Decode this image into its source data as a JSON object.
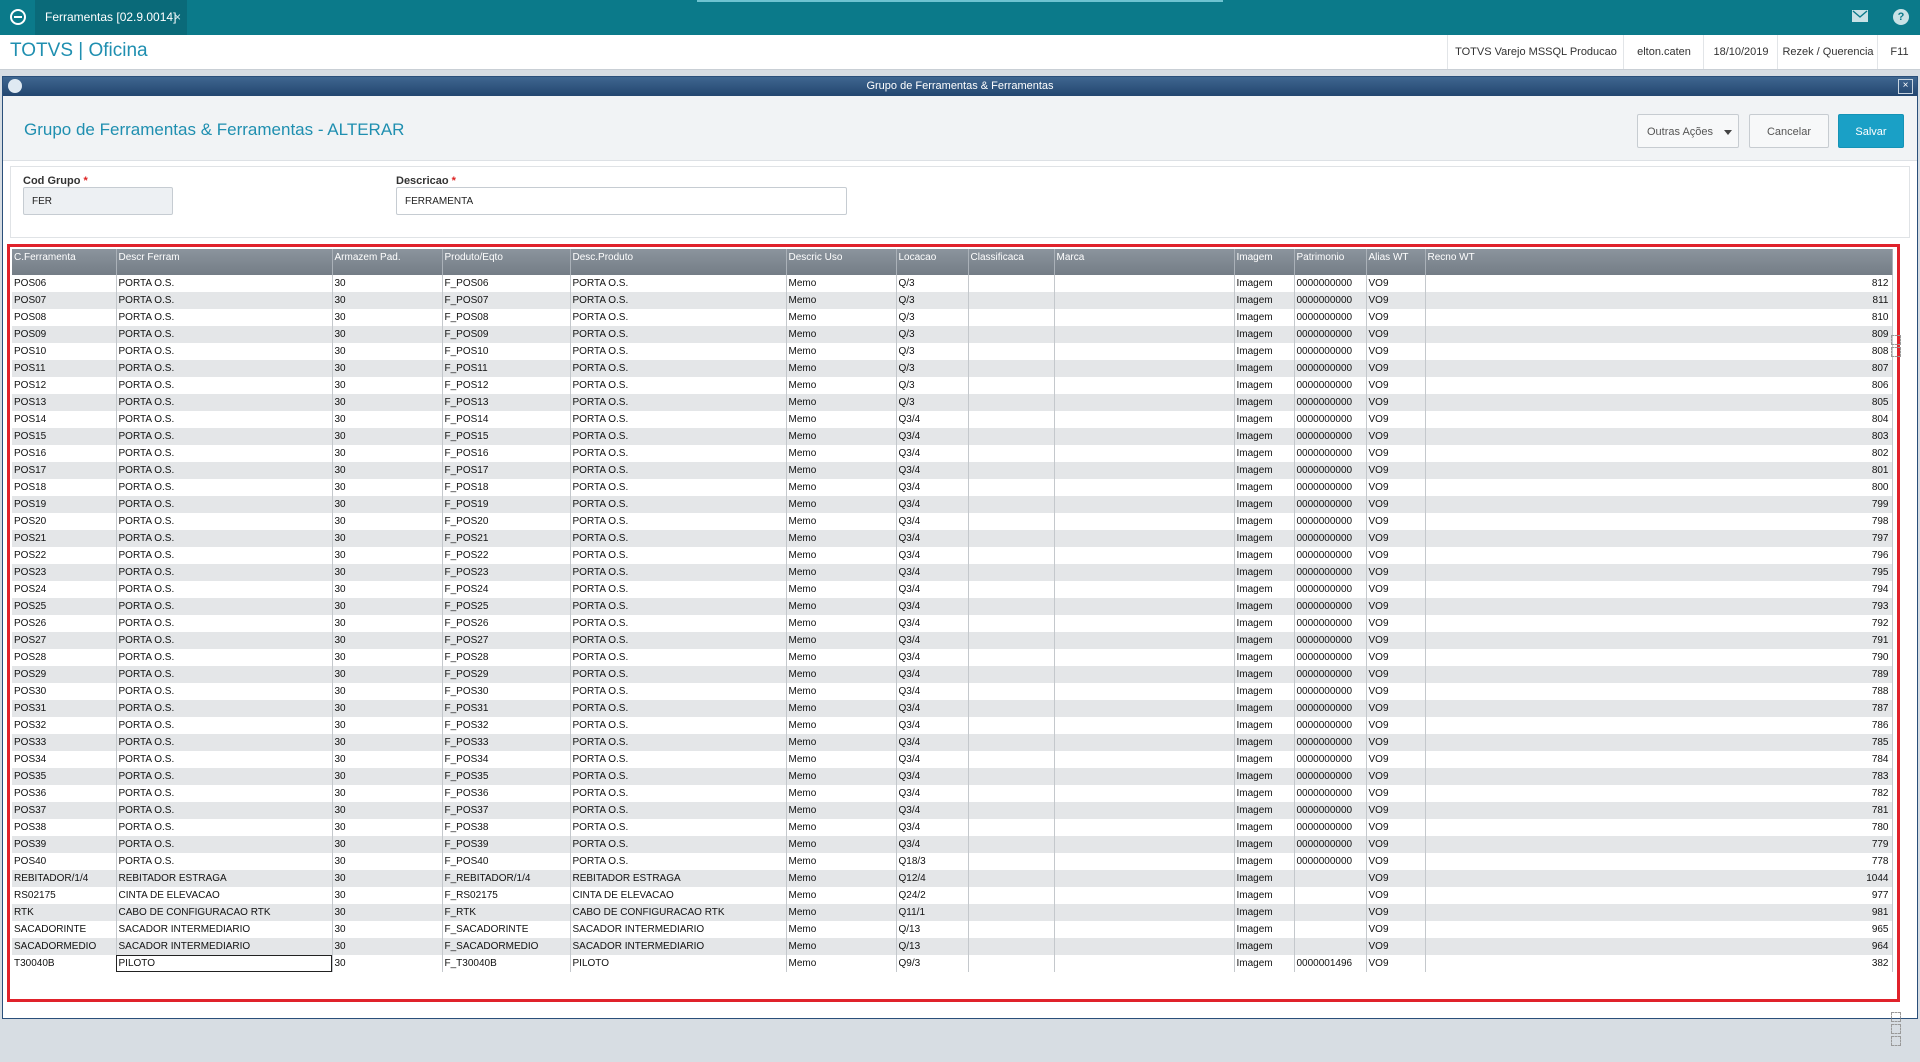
{
  "topbar": {
    "tab_label": "Ferramentas [02.9.0014]",
    "tab_close": "×",
    "help_glyph": "?"
  },
  "appbar": {
    "title": "TOTVS | Oficina",
    "environment": "TOTVS Varejo MSSQL Producao",
    "user": "elton.caten",
    "date": "18/10/2019",
    "company": "Rezek / Querencia",
    "shortcut": "F11"
  },
  "window": {
    "title": "Grupo de Ferramentas & Ferramentas",
    "close_glyph": "×"
  },
  "header": {
    "form_title": "Grupo de Ferramentas & Ferramentas - ALTERAR",
    "other_actions": "Outras Ações",
    "cancel": "Cancelar",
    "save": "Salvar"
  },
  "form": {
    "cod_grupo_label": "Cod Grupo",
    "cod_grupo_value": "FER",
    "descricao_label": "Descricao",
    "descricao_value": "FERRAMENTA",
    "required_mark": "*"
  },
  "grid": {
    "columns": [
      "C.Ferramenta",
      "Descr Ferram",
      "Armazem Pad.",
      "Produto/Eqto",
      "Desc.Produto",
      "Descric Uso",
      "Locacao",
      "Classificaca",
      "Marca",
      "Imagem",
      "Patrimonio",
      "Alias WT",
      "Recno WT"
    ],
    "rows": [
      [
        "POS06",
        "PORTA O.S.",
        "30",
        "F_POS06",
        "PORTA O.S.",
        "Memo",
        "Q/3",
        "",
        "",
        "Imagem",
        "0000000000",
        "VO9",
        "812"
      ],
      [
        "POS07",
        "PORTA O.S.",
        "30",
        "F_POS07",
        "PORTA O.S.",
        "Memo",
        "Q/3",
        "",
        "",
        "Imagem",
        "0000000000",
        "VO9",
        "811"
      ],
      [
        "POS08",
        "PORTA O.S.",
        "30",
        "F_POS08",
        "PORTA O.S.",
        "Memo",
        "Q/3",
        "",
        "",
        "Imagem",
        "0000000000",
        "VO9",
        "810"
      ],
      [
        "POS09",
        "PORTA O.S.",
        "30",
        "F_POS09",
        "PORTA O.S.",
        "Memo",
        "Q/3",
        "",
        "",
        "Imagem",
        "0000000000",
        "VO9",
        "809"
      ],
      [
        "POS10",
        "PORTA O.S.",
        "30",
        "F_POS10",
        "PORTA O.S.",
        "Memo",
        "Q/3",
        "",
        "",
        "Imagem",
        "0000000000",
        "VO9",
        "808"
      ],
      [
        "POS11",
        "PORTA O.S.",
        "30",
        "F_POS11",
        "PORTA O.S.",
        "Memo",
        "Q/3",
        "",
        "",
        "Imagem",
        "0000000000",
        "VO9",
        "807"
      ],
      [
        "POS12",
        "PORTA O.S.",
        "30",
        "F_POS12",
        "PORTA O.S.",
        "Memo",
        "Q/3",
        "",
        "",
        "Imagem",
        "0000000000",
        "VO9",
        "806"
      ],
      [
        "POS13",
        "PORTA O.S.",
        "30",
        "F_POS13",
        "PORTA O.S.",
        "Memo",
        "Q/3",
        "",
        "",
        "Imagem",
        "0000000000",
        "VO9",
        "805"
      ],
      [
        "POS14",
        "PORTA O.S.",
        "30",
        "F_POS14",
        "PORTA O.S.",
        "Memo",
        "Q3/4",
        "",
        "",
        "Imagem",
        "0000000000",
        "VO9",
        "804"
      ],
      [
        "POS15",
        "PORTA O.S.",
        "30",
        "F_POS15",
        "PORTA O.S.",
        "Memo",
        "Q3/4",
        "",
        "",
        "Imagem",
        "0000000000",
        "VO9",
        "803"
      ],
      [
        "POS16",
        "PORTA O.S.",
        "30",
        "F_POS16",
        "PORTA O.S.",
        "Memo",
        "Q3/4",
        "",
        "",
        "Imagem",
        "0000000000",
        "VO9",
        "802"
      ],
      [
        "POS17",
        "PORTA O.S.",
        "30",
        "F_POS17",
        "PORTA O.S.",
        "Memo",
        "Q3/4",
        "",
        "",
        "Imagem",
        "0000000000",
        "VO9",
        "801"
      ],
      [
        "POS18",
        "PORTA O.S.",
        "30",
        "F_POS18",
        "PORTA O.S.",
        "Memo",
        "Q3/4",
        "",
        "",
        "Imagem",
        "0000000000",
        "VO9",
        "800"
      ],
      [
        "POS19",
        "PORTA O.S.",
        "30",
        "F_POS19",
        "PORTA O.S.",
        "Memo",
        "Q3/4",
        "",
        "",
        "Imagem",
        "0000000000",
        "VO9",
        "799"
      ],
      [
        "POS20",
        "PORTA O.S.",
        "30",
        "F_POS20",
        "PORTA O.S.",
        "Memo",
        "Q3/4",
        "",
        "",
        "Imagem",
        "0000000000",
        "VO9",
        "798"
      ],
      [
        "POS21",
        "PORTA O.S.",
        "30",
        "F_POS21",
        "PORTA O.S.",
        "Memo",
        "Q3/4",
        "",
        "",
        "Imagem",
        "0000000000",
        "VO9",
        "797"
      ],
      [
        "POS22",
        "PORTA O.S.",
        "30",
        "F_POS22",
        "PORTA O.S.",
        "Memo",
        "Q3/4",
        "",
        "",
        "Imagem",
        "0000000000",
        "VO9",
        "796"
      ],
      [
        "POS23",
        "PORTA O.S.",
        "30",
        "F_POS23",
        "PORTA O.S.",
        "Memo",
        "Q3/4",
        "",
        "",
        "Imagem",
        "0000000000",
        "VO9",
        "795"
      ],
      [
        "POS24",
        "PORTA O.S.",
        "30",
        "F_POS24",
        "PORTA O.S.",
        "Memo",
        "Q3/4",
        "",
        "",
        "Imagem",
        "0000000000",
        "VO9",
        "794"
      ],
      [
        "POS25",
        "PORTA O.S.",
        "30",
        "F_POS25",
        "PORTA O.S.",
        "Memo",
        "Q3/4",
        "",
        "",
        "Imagem",
        "0000000000",
        "VO9",
        "793"
      ],
      [
        "POS26",
        "PORTA O.S.",
        "30",
        "F_POS26",
        "PORTA O.S.",
        "Memo",
        "Q3/4",
        "",
        "",
        "Imagem",
        "0000000000",
        "VO9",
        "792"
      ],
      [
        "POS27",
        "PORTA O.S.",
        "30",
        "F_POS27",
        "PORTA O.S.",
        "Memo",
        "Q3/4",
        "",
        "",
        "Imagem",
        "0000000000",
        "VO9",
        "791"
      ],
      [
        "POS28",
        "PORTA O.S.",
        "30",
        "F_POS28",
        "PORTA O.S.",
        "Memo",
        "Q3/4",
        "",
        "",
        "Imagem",
        "0000000000",
        "VO9",
        "790"
      ],
      [
        "POS29",
        "PORTA O.S.",
        "30",
        "F_POS29",
        "PORTA O.S.",
        "Memo",
        "Q3/4",
        "",
        "",
        "Imagem",
        "0000000000",
        "VO9",
        "789"
      ],
      [
        "POS30",
        "PORTA O.S.",
        "30",
        "F_POS30",
        "PORTA O.S.",
        "Memo",
        "Q3/4",
        "",
        "",
        "Imagem",
        "0000000000",
        "VO9",
        "788"
      ],
      [
        "POS31",
        "PORTA O.S.",
        "30",
        "F_POS31",
        "PORTA O.S.",
        "Memo",
        "Q3/4",
        "",
        "",
        "Imagem",
        "0000000000",
        "VO9",
        "787"
      ],
      [
        "POS32",
        "PORTA O.S.",
        "30",
        "F_POS32",
        "PORTA O.S.",
        "Memo",
        "Q3/4",
        "",
        "",
        "Imagem",
        "0000000000",
        "VO9",
        "786"
      ],
      [
        "POS33",
        "PORTA O.S.",
        "30",
        "F_POS33",
        "PORTA O.S.",
        "Memo",
        "Q3/4",
        "",
        "",
        "Imagem",
        "0000000000",
        "VO9",
        "785"
      ],
      [
        "POS34",
        "PORTA O.S.",
        "30",
        "F_POS34",
        "PORTA O.S.",
        "Memo",
        "Q3/4",
        "",
        "",
        "Imagem",
        "0000000000",
        "VO9",
        "784"
      ],
      [
        "POS35",
        "PORTA O.S.",
        "30",
        "F_POS35",
        "PORTA O.S.",
        "Memo",
        "Q3/4",
        "",
        "",
        "Imagem",
        "0000000000",
        "VO9",
        "783"
      ],
      [
        "POS36",
        "PORTA O.S.",
        "30",
        "F_POS36",
        "PORTA O.S.",
        "Memo",
        "Q3/4",
        "",
        "",
        "Imagem",
        "0000000000",
        "VO9",
        "782"
      ],
      [
        "POS37",
        "PORTA O.S.",
        "30",
        "F_POS37",
        "PORTA O.S.",
        "Memo",
        "Q3/4",
        "",
        "",
        "Imagem",
        "0000000000",
        "VO9",
        "781"
      ],
      [
        "POS38",
        "PORTA O.S.",
        "30",
        "F_POS38",
        "PORTA O.S.",
        "Memo",
        "Q3/4",
        "",
        "",
        "Imagem",
        "0000000000",
        "VO9",
        "780"
      ],
      [
        "POS39",
        "PORTA O.S.",
        "30",
        "F_POS39",
        "PORTA O.S.",
        "Memo",
        "Q3/4",
        "",
        "",
        "Imagem",
        "0000000000",
        "VO9",
        "779"
      ],
      [
        "POS40",
        "PORTA O.S.",
        "30",
        "F_POS40",
        "PORTA O.S.",
        "Memo",
        "Q18/3",
        "",
        "",
        "Imagem",
        "0000000000",
        "VO9",
        "778"
      ],
      [
        "REBITADOR/1/4",
        "REBITADOR           ESTRAGA",
        "30",
        "F_REBITADOR/1/4",
        "REBITADOR           ESTRAGA",
        "Memo",
        "Q12/4",
        "",
        "",
        "Imagem",
        "",
        "VO9",
        "1044"
      ],
      [
        "RS02175",
        "CINTA DE ELEVACAO",
        "30",
        "F_RS02175",
        "CINTA DE ELEVACAO",
        "Memo",
        "Q24/2",
        "",
        "",
        "Imagem",
        "",
        "VO9",
        "977"
      ],
      [
        "RTK",
        "CABO DE CONFIGURACAO RTK",
        "30",
        "F_RTK",
        "CABO DE CONFIGURACAO RTK",
        "Memo",
        "Q11/1",
        "",
        "",
        "Imagem",
        "",
        "VO9",
        "981"
      ],
      [
        "SACADORINTE",
        "SACADOR INTERMEDIARIO",
        "30",
        "F_SACADORINTE",
        "SACADOR INTERMEDIARIO",
        "Memo",
        "Q/13",
        "",
        "",
        "Imagem",
        "",
        "VO9",
        "965"
      ],
      [
        "SACADORMEDIO",
        "SACADOR  INTERMEDIARIO",
        "30",
        "F_SACADORMEDIO",
        "SACADOR  INTERMEDIARIO",
        "Memo",
        "Q/13",
        "",
        "",
        "Imagem",
        "",
        "VO9",
        "964"
      ],
      [
        "T30040B",
        "PILOTO",
        "30",
        "F_T30040B",
        "PILOTO",
        "Memo",
        "Q9/3",
        "",
        "",
        "Imagem",
        "0000001496",
        "VO9",
        "382"
      ]
    ]
  },
  "colors": {
    "topbar": "#0b7a8a",
    "accent": "#1f8fb0",
    "save_button": "#1aa0c6",
    "highlight_border": "#e0222b"
  }
}
